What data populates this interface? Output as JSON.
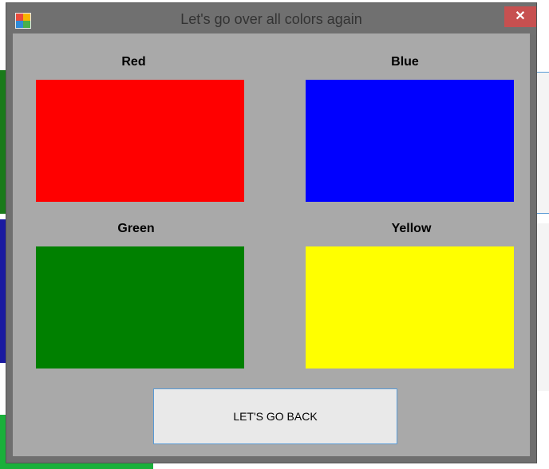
{
  "window": {
    "title": "Let's go over all colors again",
    "close_glyph": "✕",
    "app_icon": "app-grid-icon"
  },
  "colors": [
    {
      "label": "Red",
      "color": "#ff0000"
    },
    {
      "label": "Blue",
      "color": "#0000ff"
    },
    {
      "label": "Green",
      "color": "#008000"
    },
    {
      "label": "Yellow",
      "color": "#ffff00"
    }
  ],
  "back_button": {
    "label": "LET'S GO BACK"
  },
  "theme": {
    "titlebar": "#707070",
    "client_bg": "#a9a9a9",
    "close_bg": "#c75050"
  }
}
